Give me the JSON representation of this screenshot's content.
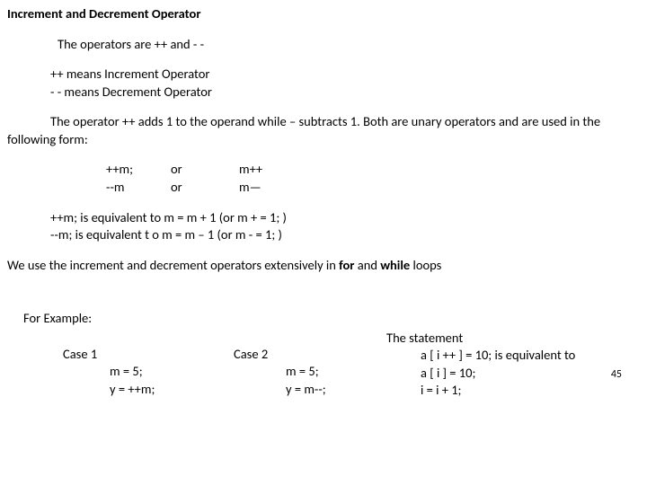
{
  "heading": "Increment and Decrement Operator",
  "intro": "The operators are ++ and - -",
  "defs": {
    "inc": "++ means Increment Operator",
    "dec": "- - means Decrement Operator"
  },
  "para": "The operator ++ adds 1 to the operand while – subtracts 1. Both are unary operators and are used in the following form:",
  "table": {
    "r1c1": "++m;",
    "r1c2": "or",
    "r1c3": "m++",
    "r2c1": "--m",
    "r2c2": "or",
    "r2c3": "m—"
  },
  "equiv": {
    "e1": "++m; is equivalent to m = m + 1 (or m + = 1; )",
    "e2": "--m; is equivalent t o m = m – 1 (or m - = 1; )"
  },
  "usage_pre": "We use the increment and decrement operators extensively in ",
  "usage_for": "for ",
  "usage_and": "and ",
  "usage_while": "while ",
  "usage_post": "loops",
  "forex": "For Example:",
  "case1": {
    "title": "Case 1",
    "l1": "m = 5;",
    "l2": "y = ++m;"
  },
  "case2": {
    "title": "Case 2",
    "l1": "m = 5;",
    "l2": "y = m--;"
  },
  "stmt": {
    "h": "The statement",
    "l1": "a [ i ++ ] = 10; is equivalent to",
    "l2": "a [ i ] = 10;",
    "l3": " i = i + 1;"
  },
  "pagenum": "45"
}
